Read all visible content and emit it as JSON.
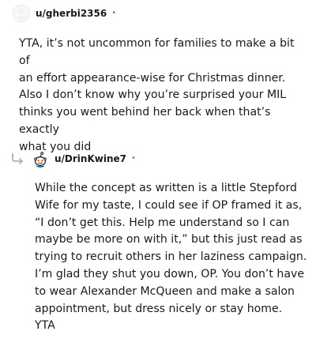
{
  "comment": {
    "username": "u/gherbi2356",
    "separator": "•",
    "text": "YTA, it’s not uncommon for families to make a bit of\nan effort appearance-wise for Christmas dinner.\nAlso I don’t know why you’re surprised your MIL\nthinks you went behind her back when that’s exactly\nwhat you did"
  },
  "reply": {
    "username": "u/DrinKwine7",
    "separator": "•",
    "text": "While the concept as written is a little Stepford\nWife for my taste, I could see if OP framed it as,\n“I don’t get this. Help me understand so I can\nmaybe be more on with it,” but this just read as\ntrying to recruit others in her laziness campaign.\nI’m glad they shut you down, OP. You don’t have\nto wear Alexander McQueen and make a salon\nappointment, but dress nicely or stay home.\nYTA"
  },
  "icons": {
    "comment_avatar": "default-user-avatar",
    "reply_avatar": "snoo-avatar",
    "reply_thread": "reply-arrow-icon"
  }
}
